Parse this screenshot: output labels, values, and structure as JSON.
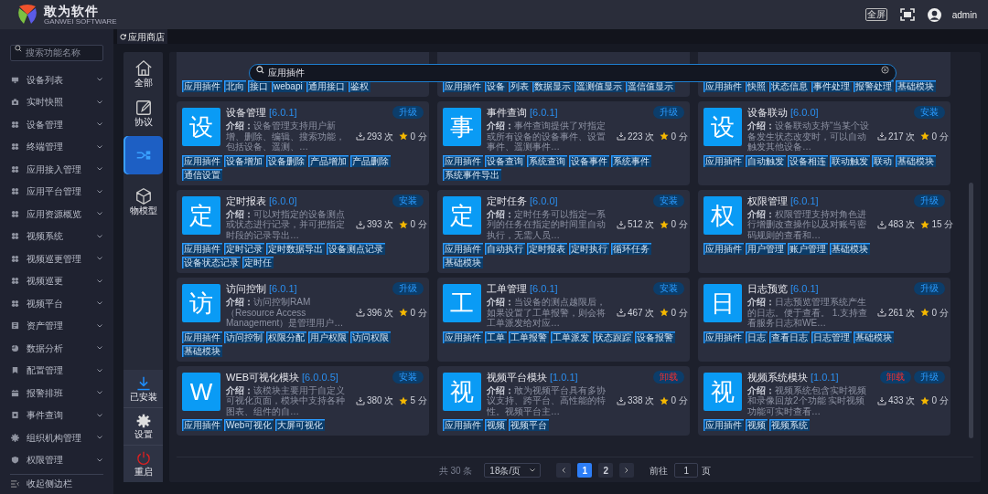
{
  "header": {
    "logo_title": "敢为软件",
    "logo_subtitle": "GANWEI SOFTWARE",
    "fullscreen_label": "全屏",
    "user": "admin"
  },
  "sidebar": {
    "search_placeholder": "搜索功能名称",
    "items": [
      {
        "label": "设备列表",
        "kind": "monitor"
      },
      {
        "label": "实时快照",
        "kind": "camera"
      },
      {
        "label": "设备管理",
        "kind": "module"
      },
      {
        "label": "终端管理",
        "kind": "module"
      },
      {
        "label": "应用接入管理",
        "kind": "module"
      },
      {
        "label": "应用平台管理",
        "kind": "module"
      },
      {
        "label": "应用资源概览",
        "kind": "module"
      },
      {
        "label": "视频系统",
        "kind": "module"
      },
      {
        "label": "视频巡更管理",
        "kind": "module"
      },
      {
        "label": "视频巡更",
        "kind": "module"
      },
      {
        "label": "视频平台",
        "kind": "module"
      },
      {
        "label": "资产管理",
        "kind": "asset"
      },
      {
        "label": "数据分析",
        "kind": "pie"
      },
      {
        "label": "配置管理",
        "kind": "book"
      },
      {
        "label": "报警排班",
        "kind": "calendar"
      },
      {
        "label": "事件查询",
        "kind": "report"
      },
      {
        "label": "组织机构管理",
        "kind": "gear"
      },
      {
        "label": "权限管理",
        "kind": "shield"
      }
    ],
    "collapse": "收起侧边栏"
  },
  "tabs": [
    {
      "label": "应用商店",
      "selected": true
    }
  ],
  "category_nav": {
    "items": [
      {
        "label": "全部",
        "kind": "home",
        "selected": false
      },
      {
        "kind": "edit",
        "label": "协议",
        "selected": false
      },
      {
        "kind": "network",
        "selected": true
      },
      {
        "label": "物模型",
        "kind": "cube",
        "selected": false
      }
    ],
    "bottom": [
      {
        "label": "已安装",
        "kind": "download"
      },
      {
        "label": "设置",
        "kind": "gear"
      },
      {
        "label": "重启",
        "kind": "power"
      }
    ]
  },
  "search": {
    "value": "应用插件"
  },
  "partial_cards": [
    {
      "tags": [
        "应用插件",
        "北向",
        "接口",
        "webapi",
        "通用接口",
        "鉴权"
      ]
    },
    {
      "tags": [
        "应用插件",
        "设备",
        "列表",
        "数据显示",
        "遥测值显示",
        "遥信值显示"
      ]
    },
    {
      "tags": [
        "应用插件",
        "快照",
        "状态信息",
        "事件处理",
        "报警处理",
        "基础模块"
      ]
    }
  ],
  "cards": [
    {
      "initial": "设",
      "title": "设备管理",
      "version": "[6.0.1]",
      "desc": "**介绍：**设备管理支持用户新增、删除、编辑、搜索功能，包括设备、遥测、…",
      "downloads": "293 次",
      "score": "0 分",
      "buttons": [
        {
          "label": "升级",
          "kind": "upgrade"
        }
      ],
      "tags": [
        "应用插件",
        "设备增加",
        "设备删除",
        "产品增加",
        "产品删除",
        "通信设置"
      ]
    },
    {
      "initial": "事",
      "title": "事件查询",
      "version": "[6.0.1]",
      "desc": "**介绍：**事件查询提供了对指定或所有设备的设备事件、设置事件、遥测事件…",
      "downloads": "223 次",
      "score": "0 分",
      "buttons": [
        {
          "label": "升级",
          "kind": "upgrade"
        }
      ],
      "tags": [
        "应用插件",
        "设备查询",
        "系统查询",
        "设备事件",
        "系统事件",
        "系统事件导出"
      ]
    },
    {
      "initial": "设",
      "title": "设备联动",
      "version": "[6.0.0]",
      "desc": "**介绍：**设备联动支持“当某个设备发生状态改变时，可以自动触发其他设备…",
      "downloads": "217 次",
      "score": "0 分",
      "buttons": [
        {
          "label": "安装",
          "kind": "install"
        }
      ],
      "tags": [
        "应用插件",
        "自动触发",
        "设备相连",
        "联动触发",
        "联动",
        "基础模块"
      ]
    },
    {
      "initial": "定",
      "title": "定时报表",
      "version": "[6.0.0]",
      "desc": "**介绍：**可以对指定的设备测点或状态进行记录，并可把指定时段的记录导出…",
      "downloads": "393 次",
      "score": "0 分",
      "buttons": [
        {
          "label": "安装",
          "kind": "install"
        }
      ],
      "tags": [
        "应用插件",
        "定时记录",
        "定时数据导出",
        "设备测点记录",
        "设备状态记录",
        "定时任"
      ]
    },
    {
      "initial": "定",
      "title": "定时任务",
      "version": "[6.0.0]",
      "desc": "**介绍：**定时任务可以指定一系列的任务在指定的时间里自动执行，无需人员…",
      "downloads": "512 次",
      "score": "0 分",
      "buttons": [
        {
          "label": "安装",
          "kind": "install"
        }
      ],
      "tags": [
        "应用插件",
        "自动执行",
        "定时报表",
        "定时执行",
        "循环任务",
        "基础模块"
      ]
    },
    {
      "initial": "权",
      "title": "权限管理",
      "version": "[6.0.1]",
      "desc": "**介绍：**权限管理支持对角色进行增删改查操作以及对账号密码规则的查看和…",
      "downloads": "483 次",
      "score": "15 分",
      "buttons": [
        {
          "label": "升级",
          "kind": "upgrade"
        }
      ],
      "tags": [
        "应用插件",
        "用户管理",
        "账户管理",
        "基础模块"
      ]
    },
    {
      "initial": "访",
      "title": "访问控制",
      "version": "[6.0.1]",
      "desc": "**介绍：**访问控制RAM（Resource Access Management）是管理用户…",
      "downloads": "396 次",
      "score": "0 分",
      "buttons": [
        {
          "label": "升级",
          "kind": "upgrade"
        }
      ],
      "tags": [
        "应用插件",
        "访问控制",
        "权限分配",
        "用户权限",
        "访问权限",
        "基础模块"
      ]
    },
    {
      "initial": "工",
      "title": "工单管理",
      "version": "[6.0.1]",
      "desc": "**介绍：**当设备的测点越限后，如果设置了工单报警，则会将工单派发给对应…",
      "downloads": "467 次",
      "score": "0 分",
      "buttons": [
        {
          "label": "安装",
          "kind": "install"
        }
      ],
      "tags": [
        "应用插件",
        "工单",
        "工单报警",
        "工单派发",
        "状态跟踪",
        "设备报警"
      ]
    },
    {
      "initial": "日",
      "title": "日志预览",
      "version": "[6.0.1]",
      "desc": "**介绍：**日志预览管理系统产生的日志。便于查看。 1.支持查看服务日志和WE…",
      "downloads": "261 次",
      "score": "0 分",
      "buttons": [
        {
          "label": "升级",
          "kind": "upgrade"
        }
      ],
      "tags": [
        "应用插件",
        "日志",
        "查看日志",
        "日志管理",
        "基础模块"
      ]
    },
    {
      "initial": "W",
      "title": "WEB可视化模块",
      "version": "[6.0.0.5]",
      "desc": "**介绍：**该模块主要用于自定义可视化页面，模块中支持各种图表、组件的自…",
      "downloads": "380 次",
      "score": "5 分",
      "buttons": [
        {
          "label": "安装",
          "kind": "install"
        }
      ],
      "tags": [
        "应用插件",
        "Web可视化",
        "大屏可视化"
      ]
    },
    {
      "initial": "视",
      "title": "视频平台模块",
      "version": "[1.0.1]",
      "desc": "**介绍：**敢为视频平台具有多协议支持、跨平台、高性能的特性。视频平台主…",
      "downloads": "338 次",
      "score": "0 分",
      "buttons": [
        {
          "label": "卸载",
          "kind": "uninstall"
        }
      ],
      "tags": [
        "应用插件",
        "视频",
        "视频平台"
      ]
    },
    {
      "initial": "视",
      "title": "视频系统模块",
      "version": "[1.0.1]",
      "desc": "**介绍：**视频系统包含实时视频和录像回放2个功能 实时视频功能可实时查看…",
      "downloads": "433 次",
      "score": "0 分",
      "buttons": [
        {
          "label": "卸载",
          "kind": "uninstall"
        },
        {
          "label": "升级",
          "kind": "upgrade"
        }
      ],
      "tags": [
        "应用插件",
        "视频",
        "视频系统"
      ]
    }
  ],
  "pagination": {
    "total": "共 30 条",
    "page_size": "18条/页",
    "pages": [
      {
        "label": "1",
        "selected": true
      },
      {
        "label": "2",
        "selected": false
      }
    ],
    "goto_label": "前往",
    "goto_value": "1",
    "goto_unit": "页"
  }
}
